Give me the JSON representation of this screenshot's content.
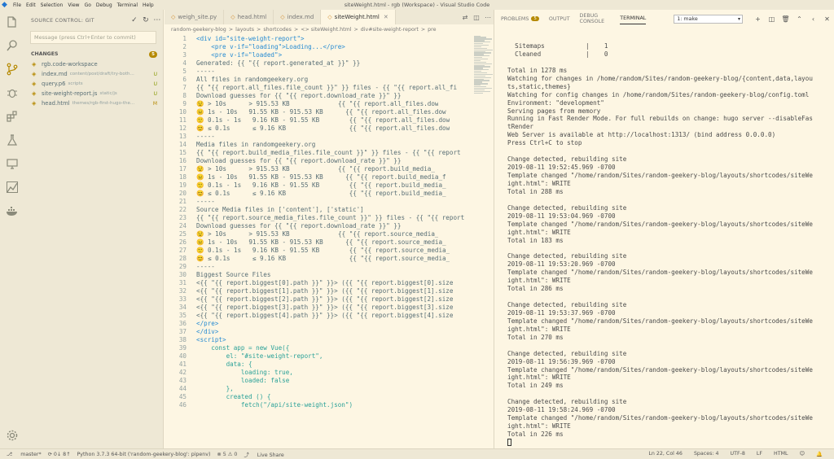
{
  "window": {
    "title": "siteWeight.html - rgb (Workspace) - Visual Studio Code",
    "menu": [
      "File",
      "Edit",
      "Selection",
      "View",
      "Go",
      "Debug",
      "Terminal",
      "Help"
    ]
  },
  "activity_bar": [
    "explorer-icon",
    "search-icon",
    "source-control-icon",
    "debug-icon",
    "extensions-icon",
    "test-icon",
    "remote-icon",
    "git-graph-icon",
    "docker-icon",
    "settings-icon"
  ],
  "sidebar": {
    "header": "SOURCE CONTROL: GIT",
    "commit_placeholder": "Message (press Ctrl+Enter to commit)",
    "changes_label": "CHANGES",
    "changes_count": "5",
    "files": [
      {
        "name": "rgb.code-workspace",
        "path": "",
        "status": ""
      },
      {
        "name": "index.md",
        "path": "content/post/draft/try-both-w...",
        "status": "U"
      },
      {
        "name": "query.p6",
        "path": "scripts",
        "status": "U"
      },
      {
        "name": "site-weight-report.js",
        "path": "static/js",
        "status": "U"
      },
      {
        "name": "head.html",
        "path": "themes/rgb-first-hugo-theme...",
        "status": "M"
      }
    ]
  },
  "editor": {
    "tabs": [
      {
        "label": "weigh_site.py",
        "active": false
      },
      {
        "label": "head.html",
        "active": false
      },
      {
        "label": "index.md",
        "active": false
      },
      {
        "label": "siteWeight.html",
        "active": true
      }
    ],
    "breadcrumbs": [
      "random-geekery-blog",
      ">",
      "layouts",
      ">",
      "shortcodes",
      ">",
      "<> siteWeight.html",
      ">",
      "div#site-weight-report",
      ">",
      "pre"
    ],
    "lines": [
      {
        "n": "1",
        "t": "<div id=\"site-weight-report\">",
        "k": "tag"
      },
      {
        "n": "2",
        "t": "    <pre v-if=\"loading\">Loading...</pre>",
        "k": "tag"
      },
      {
        "n": "3",
        "t": "    <pre v-if=\"loaded\">",
        "k": "tag"
      },
      {
        "n": "4",
        "t": "Generated: {{ \"{{ report.generated_at }}\" }}",
        "k": ""
      },
      {
        "n": "5",
        "t": "-----",
        "k": ""
      },
      {
        "n": "6",
        "t": "All files in randomgeekery.org",
        "k": ""
      },
      {
        "n": "7",
        "t": "{{ \"{{ report.all_files.file_count }}\" }} files - {{ \"{{ report.all_fi",
        "k": ""
      },
      {
        "n": "8",
        "t": "Download guesses for {{ \"{{ report.download_rate }}\" }}",
        "k": ""
      },
      {
        "n": "9",
        "t": "😟 > 10s      > 915.53 KB             {{ \"{{ report.all_files.dow",
        "k": ""
      },
      {
        "n": "10",
        "t": "😐 1s - 10s   91.55 KB - 915.53 KB      {{ \"{{ report.all_files.dow",
        "k": ""
      },
      {
        "n": "11",
        "t": "🙂 0.1s - 1s   9.16 KB - 91.55 KB        {{ \"{{ report.all_files.dow",
        "k": ""
      },
      {
        "n": "12",
        "t": "😊 ≤ 0.1s      ≤ 9.16 KB                 {{ \"{{ report.all_files.dow",
        "k": ""
      },
      {
        "n": "13",
        "t": "-----",
        "k": ""
      },
      {
        "n": "14",
        "t": "Media files in randomgeekery.org",
        "k": ""
      },
      {
        "n": "15",
        "t": "{{ \"{{ report.build_media_files.file_count }}\" }} files - {{ \"{{ report",
        "k": ""
      },
      {
        "n": "16",
        "t": "Download guesses for {{ \"{{ report.download_rate }}\" }}",
        "k": ""
      },
      {
        "n": "17",
        "t": "😟 > 10s      > 915.53 KB             {{ \"{{ report.build_media_",
        "k": ""
      },
      {
        "n": "18",
        "t": "😐 1s - 10s   91.55 KB - 915.53 KB      {{ \"{{ report.build_media_f",
        "k": ""
      },
      {
        "n": "19",
        "t": "🙂 0.1s - 1s   9.16 KB - 91.55 KB        {{ \"{{ report.build_media_",
        "k": ""
      },
      {
        "n": "20",
        "t": "😊 ≤ 0.1s      ≤ 9.16 KB                 {{ \"{{ report.build_media_",
        "k": ""
      },
      {
        "n": "21",
        "t": "-----",
        "k": ""
      },
      {
        "n": "22",
        "t": "Source Media files in ['content'], ['static']",
        "k": ""
      },
      {
        "n": "23",
        "t": "{{ \"{{ report.source_media_files.file_count }}\" }} files - {{ \"{{ report",
        "k": ""
      },
      {
        "n": "24",
        "t": "Download guesses for {{ \"{{ report.download_rate }}\" }}",
        "k": ""
      },
      {
        "n": "25",
        "t": "😟 > 10s      > 915.53 KB             {{ \"{{ report.source_media_",
        "k": ""
      },
      {
        "n": "26",
        "t": "😐 1s - 10s   91.55 KB - 915.53 KB      {{ \"{{ report.source_media_",
        "k": ""
      },
      {
        "n": "27",
        "t": "🙂 0.1s - 1s   9.16 KB - 91.55 KB        {{ \"{{ report.source_media_",
        "k": ""
      },
      {
        "n": "28",
        "t": "😊 ≤ 0.1s      ≤ 9.16 KB                 {{ \"{{ report.source_media_",
        "k": ""
      },
      {
        "n": "29",
        "t": "-----",
        "k": ""
      },
      {
        "n": "30",
        "t": "Biggest Source Files",
        "k": ""
      },
      {
        "n": "31",
        "t": "<{{ \"{{ report.biggest[0].path }}\" }}> ({{ \"{{ report.biggest[0].size",
        "k": ""
      },
      {
        "n": "32",
        "t": "<{{ \"{{ report.biggest[1].path }}\" }}> ({{ \"{{ report.biggest[1].size",
        "k": ""
      },
      {
        "n": "33",
        "t": "<{{ \"{{ report.biggest[2].path }}\" }}> ({{ \"{{ report.biggest[2].size",
        "k": ""
      },
      {
        "n": "34",
        "t": "<{{ \"{{ report.biggest[3].path }}\" }}> ({{ \"{{ report.biggest[3].size",
        "k": ""
      },
      {
        "n": "35",
        "t": "<{{ \"{{ report.biggest[4].path }}\" }}> ({{ \"{{ report.biggest[4].size",
        "k": ""
      },
      {
        "n": "36",
        "t": "</pre>",
        "k": "tag"
      },
      {
        "n": "37",
        "t": "</div>",
        "k": "tag"
      },
      {
        "n": "38",
        "t": "<script>",
        "k": "tag"
      },
      {
        "n": "39",
        "t": "    const app = new Vue({",
        "k": "js"
      },
      {
        "n": "40",
        "t": "        el: \"#site-weight-report\",",
        "k": "js"
      },
      {
        "n": "41",
        "t": "        data: {",
        "k": "js"
      },
      {
        "n": "42",
        "t": "            loading: true,",
        "k": "js"
      },
      {
        "n": "43",
        "t": "            loaded: false",
        "k": "js"
      },
      {
        "n": "44",
        "t": "        },",
        "k": "js"
      },
      {
        "n": "45",
        "t": "        created () {",
        "k": "js"
      },
      {
        "n": "46",
        "t": "            fetch(\"/api/site-weight.json\")",
        "k": "js"
      }
    ]
  },
  "panel": {
    "tabs": [
      {
        "label": "PROBLEMS",
        "badge": "5",
        "active": false
      },
      {
        "label": "OUTPUT",
        "badge": "",
        "active": false
      },
      {
        "label": "DEBUG CONSOLE",
        "badge": "",
        "active": false
      },
      {
        "label": "TERMINAL",
        "badge": "",
        "active": true
      }
    ],
    "terminal_select": "1: make",
    "terminal_lines": [
      "  Sitemaps           |    1",
      "  Cleaned            |    0",
      "",
      "Total in 1278 ms",
      "Watching for changes in /home/random/Sites/random-geekery-blog/{content,data,layou",
      "ts,static,themes}",
      "Watching for config changes in /home/random/Sites/random-geekery-blog/config.toml",
      "Environment: \"development\"",
      "Serving pages from memory",
      "Running in Fast Render Mode. For full rebuilds on change: hugo server --disableFas",
      "tRender",
      "Web Server is available at http://localhost:1313/ (bind address 0.0.0.0)",
      "Press Ctrl+C to stop",
      "",
      "Change detected, rebuilding site",
      "2019-08-11 19:52:45.969 -0700",
      "Template changed \"/home/random/Sites/random-geekery-blog/layouts/shortcodes/siteWe",
      "ight.html\": WRITE",
      "Total in 288 ms",
      "",
      "Change detected, rebuilding site",
      "2019-08-11 19:53:04.969 -0700",
      "Template changed \"/home/random/Sites/random-geekery-blog/layouts/shortcodes/siteWe",
      "ight.html\": WRITE",
      "Total in 183 ms",
      "",
      "Change detected, rebuilding site",
      "2019-08-11 19:53:20.969 -0700",
      "Template changed \"/home/random/Sites/random-geekery-blog/layouts/shortcodes/siteWe",
      "ight.html\": WRITE",
      "Total in 286 ms",
      "",
      "Change detected, rebuilding site",
      "2019-08-11 19:53:37.969 -0700",
      "Template changed \"/home/random/Sites/random-geekery-blog/layouts/shortcodes/siteWe",
      "ight.html\": WRITE",
      "Total in 270 ms",
      "",
      "Change detected, rebuilding site",
      "2019-08-11 19:56:39.969 -0700",
      "Template changed \"/home/random/Sites/random-geekery-blog/layouts/shortcodes/siteWe",
      "ight.html\": WRITE",
      "Total in 249 ms",
      "",
      "Change detected, rebuilding site",
      "2019-08-11 19:58:24.969 -0700",
      "Template changed \"/home/random/Sites/random-geekery-blog/layouts/shortcodes/siteWe",
      "ight.html\": WRITE",
      "Total in 226 ms"
    ]
  },
  "statusbar": {
    "branch": "master*",
    "sync": "⟳ 0↓ 8↑",
    "python": "Python 3.7.3 64-bit ('random-geekery-blog': pipenv)",
    "problems": "⊗ 5 ⚠ 0",
    "live_share": "Live Share",
    "position": "Ln 22, Col 46",
    "spaces": "Spaces: 4",
    "encoding": "UTF-8",
    "eol": "LF",
    "language": "HTML",
    "feedback_icon": "smiley-icon",
    "bell_icon": "bell-icon"
  }
}
